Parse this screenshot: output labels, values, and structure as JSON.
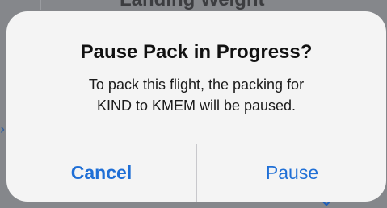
{
  "background": {
    "heading": "Landing Weight"
  },
  "alert": {
    "title": "Pause Pack in Progress?",
    "message_line1": "To pack this flight, the packing for",
    "message_line2": "KIND to KMEM will be paused.",
    "buttons": {
      "cancel_label": "Cancel",
      "pause_label": "Pause"
    }
  },
  "colors": {
    "button_text": "#1f6fd6",
    "alert_background": "#f4f4f4",
    "dim_overlay": "#85878b"
  }
}
